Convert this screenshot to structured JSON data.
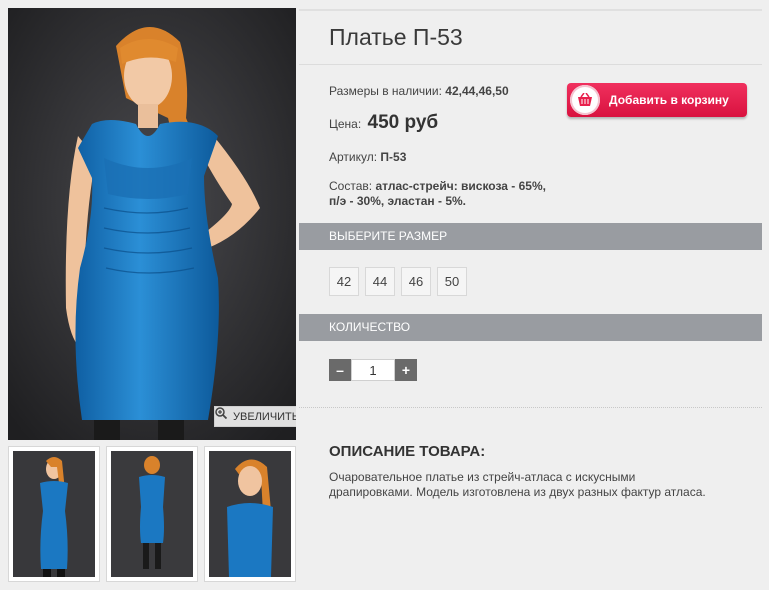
{
  "product": {
    "title": "Платье П-53",
    "sizes_label": "Размеры в наличии:",
    "sizes_value": "42,44,46,50",
    "price_label": "Цена:",
    "price_value": "450 руб",
    "article_label": "Артикул:",
    "article_value": "П-53",
    "composition_label": "Состав:",
    "composition_value": "атлас-стрейч: вискоза - 65%, п/э - 30%, эластан - 5%."
  },
  "cart": {
    "label": "Добавить в корзину",
    "icon": "basket-icon"
  },
  "gallery": {
    "zoom_label": "УВЕЛИЧИТЬ",
    "zoom_icon": "magnifier-plus-icon"
  },
  "size_section": {
    "title": "ВЫБЕРИТЕ РАЗМЕР",
    "options": [
      "42",
      "44",
      "46",
      "50"
    ]
  },
  "quantity_section": {
    "title": "КОЛИЧЕСТВО",
    "minus": "–",
    "plus": "+",
    "value": "1"
  },
  "description": {
    "title": "ОПИСАНИЕ ТОВАРА:",
    "text": "Очаровательное платье из стрейч-атласа с искусными драпировками. Модель изготовлена из двух разных фактур атласа."
  },
  "colors": {
    "accent": "#e8214d",
    "bar": "#999ca1",
    "dress": "#1b78c2"
  }
}
